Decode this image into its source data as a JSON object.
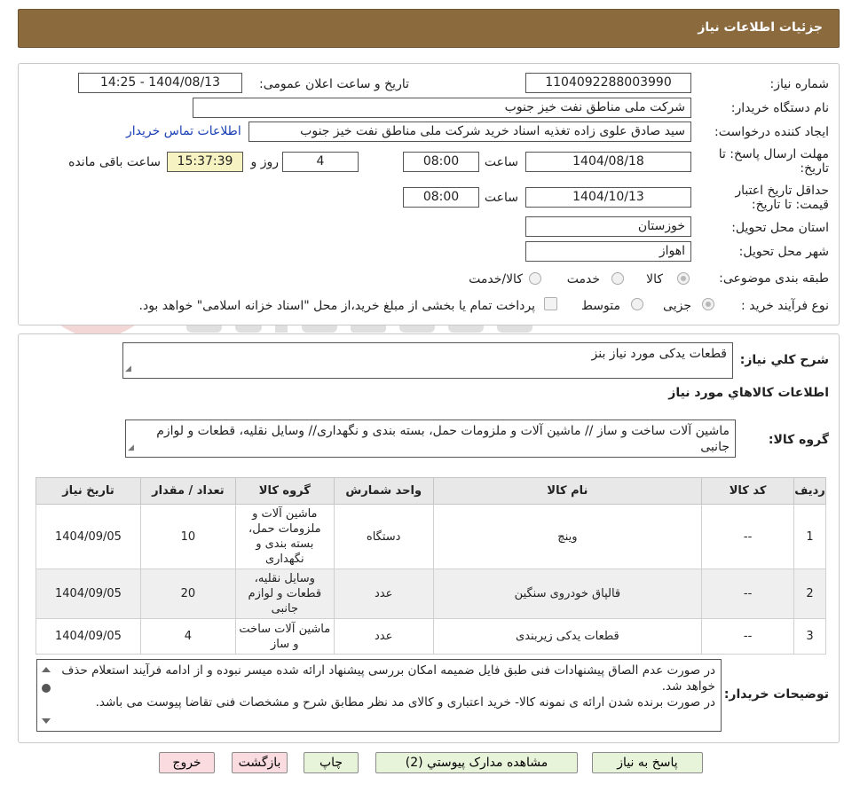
{
  "header": {
    "title": "جزئیات اطلاعات نیاز"
  },
  "form": {
    "need_number_label": "شماره نیاز:",
    "need_number": "1104092288003990",
    "announce_label": "تاریخ و ساعت اعلان عمومی:",
    "announce_value": "1404/08/13 - 14:25",
    "buyer_org_label": "نام دستگاه خریدار:",
    "buyer_org": "شرکت ملی مناطق نفت خیز جنوب",
    "creator_label": "ایجاد کننده درخواست:",
    "creator": "سید صادق علوی زاده  تغذیه اسناد خرید  شرکت ملی مناطق نفت خیز جنوب",
    "contact_link": "اطلاعات تماس خریدار",
    "deadline_label": "مهلت ارسال پاسخ: تا تاریخ:",
    "deadline_date": "1404/08/18",
    "time_label": "ساعت",
    "deadline_time": "08:00",
    "days_value": "4",
    "days_label": "روز و",
    "remaining_time": "15:37:39",
    "remaining_label": "ساعت باقی مانده",
    "validity_label": "حداقل تاریخ اعتبار قیمت: تا تاریخ:",
    "validity_date": "1404/10/13",
    "validity_time": "08:00",
    "province_label": "استان محل تحویل:",
    "province": "خوزستان",
    "city_label": "شهر محل تحویل:",
    "city": "اهواز",
    "category_label": "طبقه بندی موضوعی:",
    "category_options": [
      "کالا",
      "خدمت",
      "کالا/خدمت"
    ],
    "process_label": "نوع فرآیند خرید :",
    "process_options": [
      "جزیی",
      "متوسط"
    ],
    "payment_note": "پرداخت تمام یا بخشی از مبلغ خرید،از محل \"اسناد خزانه اسلامی\" خواهد بود."
  },
  "details": {
    "summary_label": "شرح کلي نياز:",
    "summary": "قطعات یدکی مورد نیاز بنز",
    "goods_info_title": "اطلاعات کالاهاي مورد نياز",
    "group_label": "گروه کالا:",
    "group_value": "ماشین آلات ساخت و ساز // ماشین آلات و ملزومات حمل، بسته بندی و نگهداری// وسایل نقلیه، قطعات و لوازم جانبی"
  },
  "table": {
    "headers": [
      "ردیف",
      "کد کالا",
      "نام کالا",
      "واحد شمارش",
      "گروه کالا",
      "تعداد / مقدار",
      "تاریخ نیاز"
    ],
    "rows": [
      {
        "row": "1",
        "code": "--",
        "name": "وینچ",
        "unit": "دستگاه",
        "group": "ماشین آلات و ملزومات حمل، بسته بندی و نگهداری",
        "qty": "10",
        "date": "1404/09/05"
      },
      {
        "row": "2",
        "code": "--",
        "name": "قالپاق خودروی سنگین",
        "unit": "عدد",
        "group": "وسایل نقلیه، قطعات و لوازم جانبی",
        "qty": "20",
        "date": "1404/09/05"
      },
      {
        "row": "3",
        "code": "--",
        "name": "قطعات یدکی زیربندی",
        "unit": "عدد",
        "group": "ماشین آلات ساخت و ساز",
        "qty": "4",
        "date": "1404/09/05"
      }
    ]
  },
  "buyer_notes": {
    "label": "توضیحات خریدار:",
    "line1": "در صورت عدم الصاق پیشنهادات فنی طبق فایل ضمیمه امکان بررسی پیشنهاد ارائه شده میسر نبوده و از ادامه فرآیند استعلام حذف خواهد شد.",
    "line2": "در صورت برنده شدن ارائه ی نمونه کالا- خرید اعتباری و کالای مد نظر مطابق شرح و مشخصات فنی تقاضا پیوست می باشد."
  },
  "buttons": {
    "reply": "پاسخ به نیاز",
    "attachments": "مشاهده مدارک پیوستي (2)",
    "print": "چاپ",
    "back": "بازگشت",
    "exit": "خروج"
  },
  "colors": {
    "header_bg": "#8b6a3e",
    "button_green": "#e8f4d9",
    "button_pink": "#f9dbe0",
    "link": "#1a3fb3"
  }
}
